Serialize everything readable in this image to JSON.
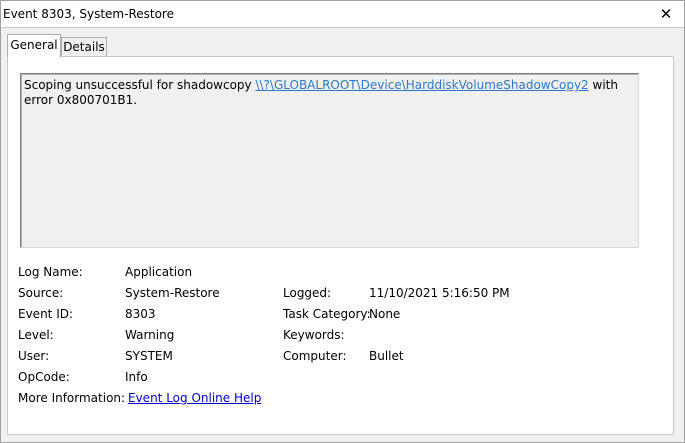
{
  "window": {
    "title": "Event 8303, System-Restore",
    "close_glyph": "✕"
  },
  "tabs": [
    {
      "label": "General",
      "active": true
    },
    {
      "label": "Details",
      "active": false
    }
  ],
  "description": {
    "prefix": "Scoping unsuccessful for shadowcopy ",
    "link": "\\\\?\\GLOBALROOT\\Device\\HarddiskVolumeShadowCopy2",
    "suffix": " with error 0x800701B1."
  },
  "fields": {
    "log_name": {
      "label": "Log Name:",
      "value": "Application"
    },
    "source": {
      "label": "Source:",
      "value": "System-Restore"
    },
    "event_id": {
      "label": "Event ID:",
      "value": "8303"
    },
    "level": {
      "label": "Level:",
      "value": "Warning"
    },
    "user": {
      "label": "User:",
      "value": "SYSTEM"
    },
    "opcode": {
      "label": "OpCode:",
      "value": "Info"
    },
    "more_info": {
      "label": "More Information:",
      "value": "Event Log Online Help"
    },
    "logged": {
      "label": "Logged:",
      "value": "11/10/2021 5:16:50 PM"
    },
    "task_category": {
      "label": "Task Category:",
      "value": "None"
    },
    "keywords": {
      "label": "Keywords:",
      "value": ""
    },
    "computer": {
      "label": "Computer:",
      "value": "Bullet"
    }
  },
  "colors": {
    "link_description": "#2e78c7",
    "link_help": "#0000cc"
  }
}
